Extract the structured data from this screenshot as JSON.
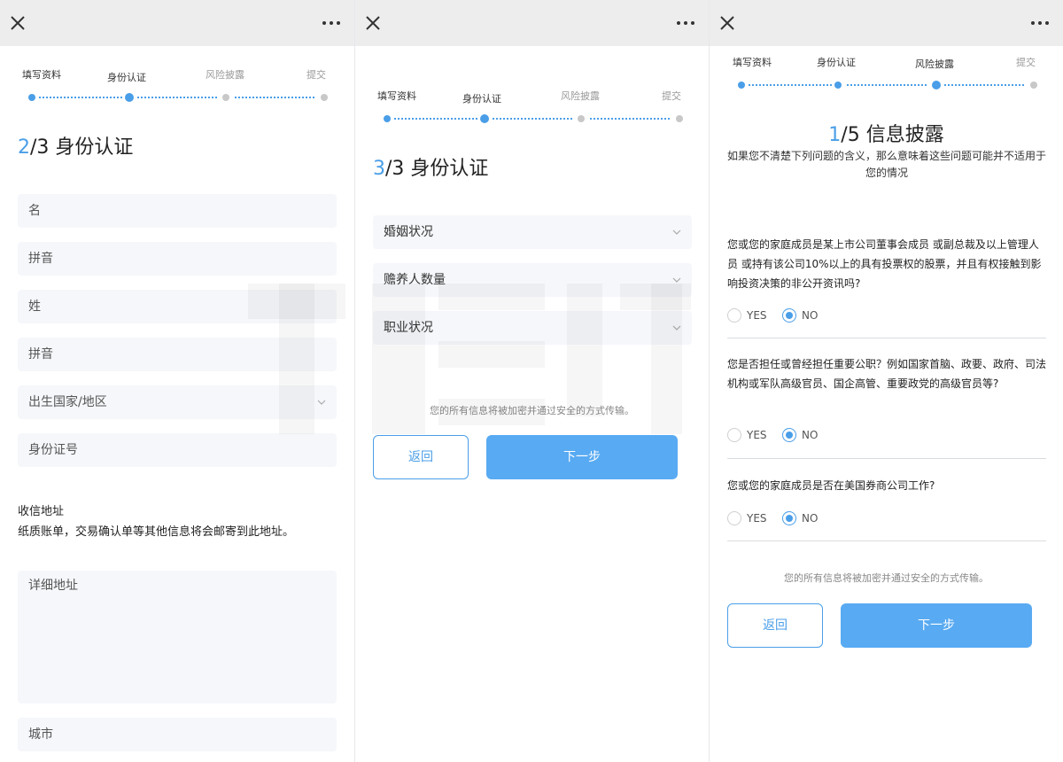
{
  "steps": [
    "填写资料",
    "身份认证",
    "风险披露",
    "提交"
  ],
  "panel1": {
    "section_num": "2",
    "section_rest": "/3 身份认证",
    "fields": {
      "given_name": "名",
      "given_pinyin": "拼音",
      "surname": "姓",
      "surname_pinyin": "拼音",
      "birth_country": "出生国家/地区",
      "id_number": "身份证号"
    },
    "address_title": "收信地址",
    "address_desc": "纸质账单，交易确认单等其他信息将会邮寄到此地址。",
    "detail_address": "详细地址",
    "city": "城市"
  },
  "panel2": {
    "section_num": "3",
    "section_rest": "/3 身份认证",
    "selects": {
      "marital": "婚姻状况",
      "dependents": "赡养人数量",
      "employment": "职业状况"
    },
    "note": "您的所有信息将被加密并通过安全的方式传输。",
    "back": "返回",
    "next": "下一步"
  },
  "panel3": {
    "section_num": "1",
    "section_rest": "/5 信息披露",
    "subtitle": "如果您不清楚下列问题的含义，那么意味着这些问题可能并不适用于您的情况",
    "questions": [
      {
        "text": "您或您的家庭成员是某上市公司董事会成员 或副总裁及以上管理人员 或持有该公司10%以上的具有投票权的股票，并且有权接触到影响投资决策的非公开资讯吗?",
        "yes": "YES",
        "no": "NO",
        "selected": "NO"
      },
      {
        "text": "您是否担任或曾经担任重要公职？例如国家首脑、政要、政府、司法机构或军队高级官员、国企高管、重要政党的高级官员等?",
        "yes": "YES",
        "no": "NO",
        "selected": "NO"
      },
      {
        "text": "您或您的家庭成员是否在美国券商公司工作?",
        "yes": "YES",
        "no": "NO",
        "selected": "NO"
      }
    ],
    "note": "您的所有信息将被加密并通过安全的方式传输。",
    "back": "返回",
    "next": "下一步"
  },
  "colors": {
    "accent": "#4a9ee8",
    "button": "#58aaf2",
    "topbar": "#ededed",
    "field_bg": "#f5f7fa"
  }
}
